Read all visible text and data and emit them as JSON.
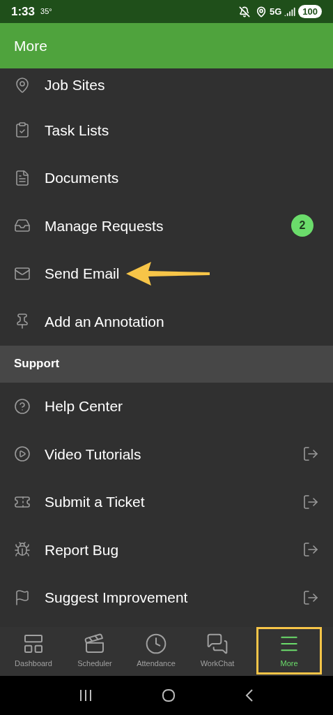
{
  "status_bar": {
    "time": "1:33",
    "temperature": "35°",
    "network": "5G",
    "battery": "100"
  },
  "app_bar": {
    "title": "More"
  },
  "sections": [
    {
      "items": [
        {
          "label": "Job Sites",
          "kind": "internal",
          "arrow_annotation": false
        },
        {
          "label": "Task Lists",
          "kind": "internal",
          "arrow_annotation": false
        },
        {
          "label": "Documents",
          "kind": "internal",
          "arrow_annotation": false
        },
        {
          "label": "Manage Requests",
          "kind": "internal",
          "badge": "2",
          "arrow_annotation": false
        },
        {
          "label": "Send Email",
          "kind": "internal",
          "arrow_annotation": true
        },
        {
          "label": "Add an Annotation",
          "kind": "internal",
          "arrow_annotation": false
        }
      ]
    },
    {
      "header": "Support",
      "items": [
        {
          "label": "Help Center",
          "kind": "internal",
          "arrow_annotation": false
        },
        {
          "label": "Video Tutorials",
          "kind": "external",
          "arrow_annotation": false
        },
        {
          "label": "Submit a Ticket",
          "kind": "external",
          "arrow_annotation": false
        },
        {
          "label": "Report Bug",
          "kind": "external",
          "arrow_annotation": false
        },
        {
          "label": "Suggest Improvement",
          "kind": "external",
          "arrow_annotation": false
        }
      ]
    }
  ],
  "bottom_nav": [
    {
      "label": "Dashboard",
      "selected": false,
      "highlighted": false
    },
    {
      "label": "Scheduler",
      "selected": false,
      "highlighted": false
    },
    {
      "label": "Attendance",
      "selected": false,
      "highlighted": false
    },
    {
      "label": "WorkChat",
      "selected": false,
      "highlighted": false
    },
    {
      "label": "More",
      "selected": true,
      "highlighted": true
    }
  ]
}
